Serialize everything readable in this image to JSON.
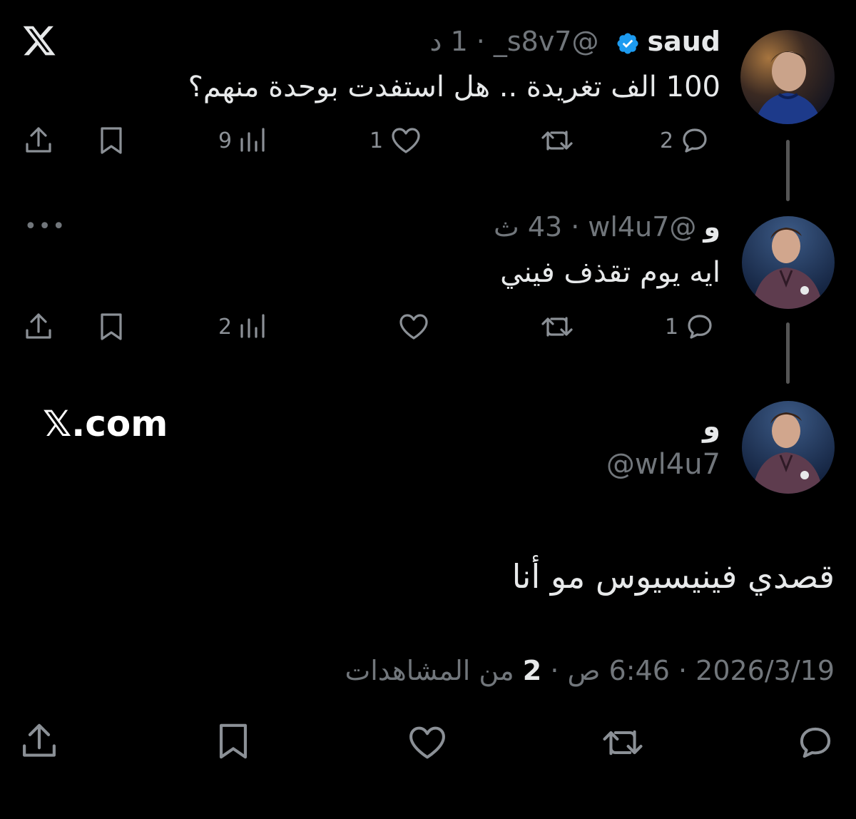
{
  "icons": {
    "logo": "x-logo-icon",
    "verified": "verified-badge-icon",
    "reply": "reply-icon",
    "repost": "repost-icon",
    "like": "like-icon",
    "views": "views-icon",
    "bookmark": "bookmark-icon",
    "share": "share-icon",
    "more": "more-icon"
  },
  "colors": {
    "background": "#000000",
    "text": "#e7e9ea",
    "secondary": "#71767b",
    "verified": "#1d9bf0"
  },
  "tweet1": {
    "name": "saud",
    "handle": "@s8v7_",
    "time": "1 د",
    "text": "100 الف تغريدة .. هل استفدت بوحدة منهم؟",
    "replies": "2",
    "reposts": "",
    "likes": "1",
    "views": "9"
  },
  "tweet2": {
    "name": "و",
    "handle": "@wl4u7",
    "time": "43 ث",
    "text": "ايه يوم تقذف فيني",
    "replies": "1",
    "reposts": "",
    "likes": "",
    "views": "2",
    "more": "•••"
  },
  "main": {
    "name": "و",
    "handle": "@wl4u7",
    "text": "قصدي فينيسيوس مو أنا",
    "date": "2026/3/19",
    "time": "6:46 ص",
    "views_count": "2",
    "views_label": "من المشاهدات",
    "watermark": "𝕏.com"
  }
}
